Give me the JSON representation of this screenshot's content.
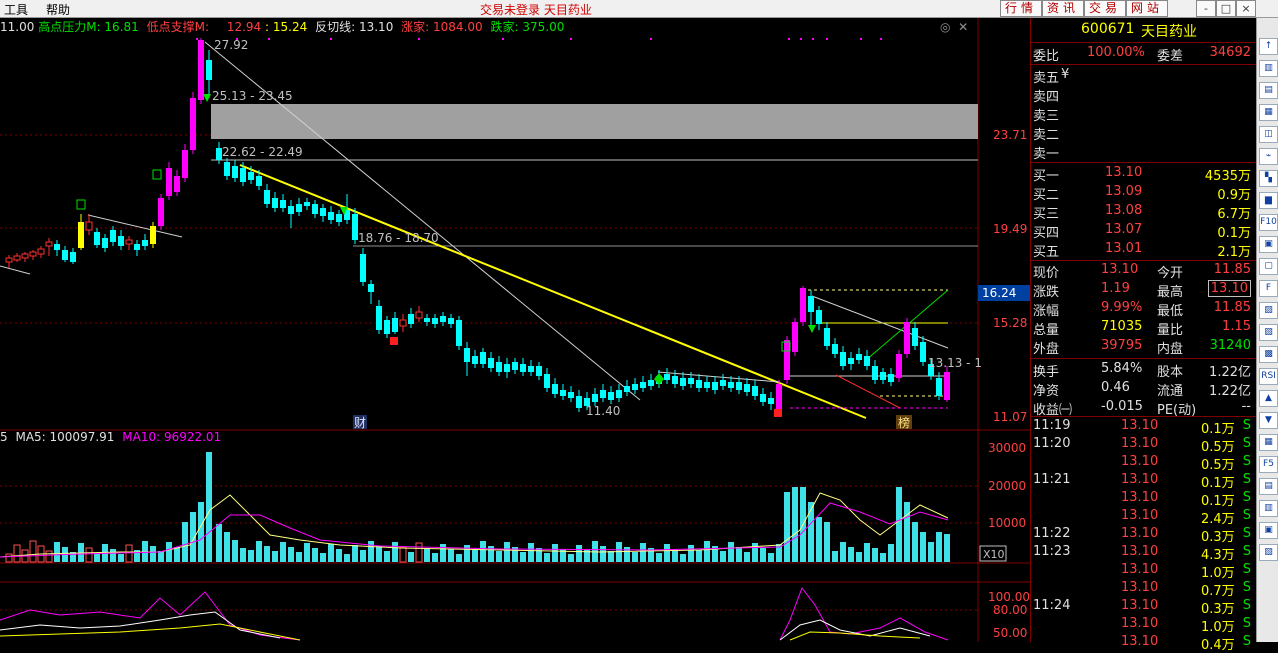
{
  "menu": [
    "工具",
    "帮助"
  ],
  "title_center": "交易未登录  天目药业",
  "top_tabs": [
    "行情",
    "资讯",
    "交易",
    "网站"
  ],
  "win_buttons": [
    "-",
    "□",
    "×"
  ],
  "legend": {
    "prefix": "11.00",
    "pressure_label": "高点压力M:",
    "pressure_val": "16.81",
    "support_label": "低点支撑M:",
    "support_val": "12.94",
    "val3": "15.24",
    "reverse_label": "反切线:",
    "reverse_val": "13.10",
    "up_label": "涨家:",
    "up_val": "1084.00",
    "down_label": "跌家:",
    "down_val": "375.00"
  },
  "vol_legend": {
    "prefix": "5",
    "ma5": "MA5: 100097.91",
    "ma10": "MA10: 96922.01"
  },
  "price_axis": [
    "23.71",
    "19.49",
    "16.24",
    "15.28",
    "11.07"
  ],
  "vol_axis": [
    "30000",
    "20000",
    "10000",
    "X10"
  ],
  "ind_axis": [
    "100.00",
    "80.00",
    "50.00"
  ],
  "annotations": {
    "high": "27.92",
    "zone1": "25.13 - 23.45",
    "zone2": "22.62 - 22.49",
    "zone3": "18.76 - 18.70",
    "low": "11.40",
    "right": "13.13 - 1",
    "cai": "财",
    "bang": "榜"
  },
  "stock": {
    "code": "600671",
    "name": "天目药业"
  },
  "weibi": {
    "label1": "委比",
    "val1": "100.00%",
    "label2": "委差",
    "val2": "34692"
  },
  "sell": [
    {
      "label": "卖五",
      "extra": "¥"
    },
    {
      "label": "卖四",
      "extra": ""
    },
    {
      "label": "卖三",
      "extra": ""
    },
    {
      "label": "卖二",
      "extra": ""
    },
    {
      "label": "卖一",
      "extra": ""
    }
  ],
  "buy": [
    {
      "label": "买一",
      "price": "13.10",
      "vol": "4535万"
    },
    {
      "label": "买二",
      "price": "13.09",
      "vol": "0.9万"
    },
    {
      "label": "买三",
      "price": "13.08",
      "vol": "6.7万"
    },
    {
      "label": "买四",
      "price": "13.07",
      "vol": "0.1万"
    },
    {
      "label": "买五",
      "price": "13.01",
      "vol": "2.1万"
    }
  ],
  "quote": [
    {
      "l1": "现价",
      "v1": "13.10",
      "l2": "今开",
      "v2": "11.85"
    },
    {
      "l1": "涨跌",
      "v1": "1.19",
      "l2": "最高",
      "v2": "13.10"
    },
    {
      "l1": "涨幅",
      "v1": "9.99%",
      "l2": "最低",
      "v2": "11.85"
    },
    {
      "l1": "总量",
      "v1": "71035",
      "l2": "量比",
      "v2": "1.15"
    },
    {
      "l1": "外盘",
      "v1": "39795",
      "l2": "内盘",
      "v2": "31240"
    }
  ],
  "finance": [
    {
      "l1": "换手",
      "v1": "5.84%",
      "l2": "股本",
      "v2": "1.22亿"
    },
    {
      "l1": "净资",
      "v1": "0.46",
      "l2": "流通",
      "v2": "1.22亿"
    },
    {
      "l1": "收益㈠",
      "v1": "-0.015",
      "l2": "PE(动)",
      "v2": "--"
    }
  ],
  "ticks": [
    {
      "time": "11:19",
      "price": "13.10",
      "vol": "0.1万",
      "bs": "S"
    },
    {
      "time": "11:20",
      "price": "13.10",
      "vol": "0.5万",
      "bs": "S"
    },
    {
      "time": "",
      "price": "13.10",
      "vol": "0.5万",
      "bs": "S"
    },
    {
      "time": "11:21",
      "price": "13.10",
      "vol": "0.1万",
      "bs": "S"
    },
    {
      "time": "",
      "price": "13.10",
      "vol": "0.1万",
      "bs": "S"
    },
    {
      "time": "",
      "price": "13.10",
      "vol": "2.4万",
      "bs": "S"
    },
    {
      "time": "11:22",
      "price": "13.10",
      "vol": "0.3万",
      "bs": "S"
    },
    {
      "time": "11:23",
      "price": "13.10",
      "vol": "4.3万",
      "bs": "S"
    },
    {
      "time": "",
      "price": "13.10",
      "vol": "1.0万",
      "bs": "S"
    },
    {
      "time": "",
      "price": "13.10",
      "vol": "0.7万",
      "bs": "S"
    },
    {
      "time": "11:24",
      "price": "13.10",
      "vol": "0.3万",
      "bs": "S"
    },
    {
      "time": "",
      "price": "13.10",
      "vol": "1.0万",
      "bs": "S"
    },
    {
      "time": "",
      "price": "13.10",
      "vol": "0.4万",
      "bs": "S"
    }
  ],
  "toolbar_icons": [
    "↑",
    "▥",
    "▤",
    "▦",
    "◫",
    "⌁",
    "▚",
    "▆",
    "F10",
    "▣",
    "▢",
    "F",
    "▨",
    "▧",
    "▩",
    "RSI",
    "▲",
    "▼",
    "▦",
    "F5",
    "▤",
    "▥",
    "▣",
    "▧"
  ],
  "colors": {
    "up": "#ff3030",
    "down": "#00ffff",
    "trend": "#ffff00",
    "limit": "#ff00ff"
  }
}
